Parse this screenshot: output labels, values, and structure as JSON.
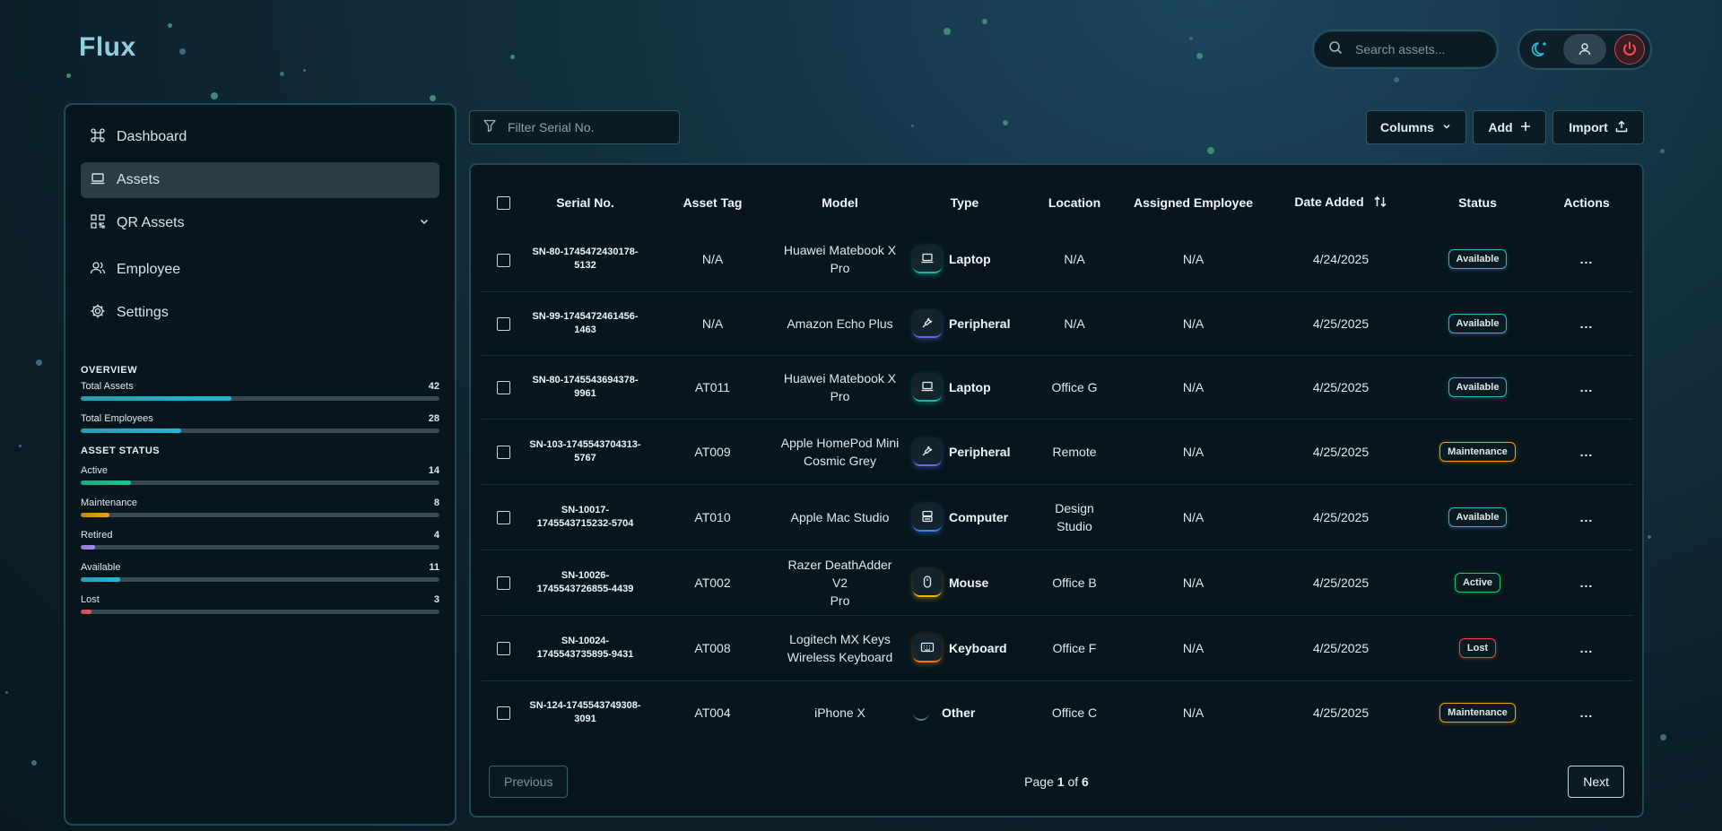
{
  "app": {
    "title": "Flux"
  },
  "search": {
    "placeholder": "Search assets..."
  },
  "sidebar": {
    "items": [
      {
        "label": "Dashboard",
        "icon": "command-icon"
      },
      {
        "label": "Assets",
        "icon": "laptop-icon",
        "active": true
      },
      {
        "label": "QR Assets",
        "icon": "qr-code-icon"
      },
      {
        "label": "Employee",
        "icon": "users-icon"
      },
      {
        "label": "Settings",
        "icon": "gear-icon"
      }
    ],
    "overview_title": "OVERVIEW",
    "overview": [
      {
        "label": "Total Assets",
        "value": "42",
        "fraction": 0.42,
        "color": "#22b8d6"
      },
      {
        "label": "Total Employees",
        "value": "28",
        "fraction": 0.28,
        "color": "#22b8d6"
      }
    ],
    "status_title": "ASSET STATUS",
    "status": [
      {
        "label": "Active",
        "value": "14",
        "fraction": 0.14,
        "color": "#22c58b"
      },
      {
        "label": "Maintenance",
        "value": "8",
        "fraction": 0.08,
        "color": "#f59e0b"
      },
      {
        "label": "Retired",
        "value": "4",
        "fraction": 0.04,
        "color": "#a78bfa"
      },
      {
        "label": "Available",
        "value": "11",
        "fraction": 0.11,
        "color": "#22b8d6"
      },
      {
        "label": "Lost",
        "value": "3",
        "fraction": 0.03,
        "color": "#f0505a"
      }
    ]
  },
  "toolbar": {
    "filter_placeholder": "Filter Serial No.",
    "columns_label": "Columns",
    "add_label": "Add",
    "import_label": "Import"
  },
  "table": {
    "headers": [
      "Serial No.",
      "Asset Tag",
      "Model",
      "Type",
      "Location",
      "Assigned Employee",
      "Date Added",
      "Status",
      "Actions"
    ],
    "rows": [
      {
        "serial": [
          "SN-80-1745472430178-",
          "5132"
        ],
        "tag": "N/A",
        "model": [
          "Huawei Matebook X Pro"
        ],
        "type": "Laptop",
        "location": [
          "N/A"
        ],
        "employee": "N/A",
        "date": "4/24/2025",
        "status": "Available"
      },
      {
        "serial": [
          "SN-99-1745472461456-",
          "1463"
        ],
        "tag": "N/A",
        "model": [
          "Amazon Echo Plus"
        ],
        "type": "Peripheral",
        "location": [
          "N/A"
        ],
        "employee": "N/A",
        "date": "4/25/2025",
        "status": "Available"
      },
      {
        "serial": [
          "SN-80-1745543694378-",
          "9961"
        ],
        "tag": "AT011",
        "model": [
          "Huawei Matebook X Pro"
        ],
        "type": "Laptop",
        "location": [
          "Office G"
        ],
        "employee": "N/A",
        "date": "4/25/2025",
        "status": "Available"
      },
      {
        "serial": [
          "SN-103-1745543704313-",
          "5767"
        ],
        "tag": "AT009",
        "model": [
          "Apple HomePod Mini",
          "Cosmic Grey"
        ],
        "type": "Peripheral",
        "location": [
          "Remote"
        ],
        "employee": "N/A",
        "date": "4/25/2025",
        "status": "Maintenance"
      },
      {
        "serial": [
          "SN-10017-",
          "1745543715232-5704"
        ],
        "tag": "AT010",
        "model": [
          "Apple Mac Studio"
        ],
        "type": "Computer",
        "location": [
          "Design",
          "Studio"
        ],
        "employee": "N/A",
        "date": "4/25/2025",
        "status": "Available"
      },
      {
        "serial": [
          "SN-10026-",
          "1745543726855-4439"
        ],
        "tag": "AT002",
        "model": [
          "Razer DeathAdder V2",
          "Pro"
        ],
        "type": "Mouse",
        "location": [
          "Office B"
        ],
        "employee": "N/A",
        "date": "4/25/2025",
        "status": "Active"
      },
      {
        "serial": [
          "SN-10024-",
          "1745543735895-9431"
        ],
        "tag": "AT008",
        "model": [
          "Logitech MX Keys",
          "Wireless Keyboard"
        ],
        "type": "Keyboard",
        "location": [
          "Office F"
        ],
        "employee": "N/A",
        "date": "4/25/2025",
        "status": "Lost"
      },
      {
        "serial": [
          "SN-124-1745543749308-",
          "3091"
        ],
        "tag": "AT004",
        "model": [
          "iPhone X"
        ],
        "type": "Other",
        "location": [
          "Office C"
        ],
        "employee": "N/A",
        "date": "4/25/2025",
        "status": "Maintenance"
      }
    ],
    "actions_glyph": "..."
  },
  "type_styles": {
    "Laptop": {
      "icon": "laptop-icon",
      "color": "#14b8a6"
    },
    "Peripheral": {
      "icon": "plug-icon",
      "color": "#6366f1"
    },
    "Computer": {
      "icon": "server-icon",
      "color": "#3b82f6"
    },
    "Mouse": {
      "icon": "mouse-icon",
      "color": "#eab308"
    },
    "Keyboard": {
      "icon": "keyboard-icon",
      "color": "#f97316"
    },
    "Other": {
      "icon": "circle-icon",
      "color": "#64748b"
    }
  },
  "status_styles": {
    "Available": "#22b8d6",
    "Maintenance": "#f59e0b",
    "Active": "#22c55e",
    "Lost": "#ef4444"
  },
  "pagination": {
    "previous_label": "Previous",
    "next_label": "Next",
    "page_word": "Page",
    "current": "1",
    "of_word": "of",
    "total": "6"
  }
}
